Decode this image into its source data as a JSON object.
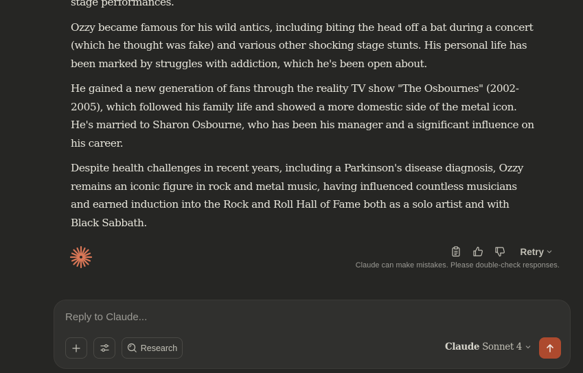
{
  "message": {
    "partial_line": "stage performances.",
    "paragraphs": [
      "Ozzy became famous for his wild antics, including biting the head off a bat during a concert (which he thought was fake) and various other shocking stage stunts. His personal life has been marked by struggles with addiction, which he's been open about.",
      "He gained a new generation of fans through the reality TV show \"The Osbournes\" (2002-2005), which followed his family life and showed a more domestic side of the metal icon. He's married to Sharon Osbourne, who has been his manager and a significant influence on his career.",
      "Despite health challenges in recent years, including a Parkinson's disease diagnosis, Ozzy remains an iconic figure in rock and metal music, having influenced countless musicians and earned induction into the Rock and Roll Hall of Fame both as a solo artist and with Black Sabbath."
    ]
  },
  "message_actions": {
    "copy_icon": "clipboard-icon",
    "thumbs_up_icon": "thumbs-up-icon",
    "thumbs_down_icon": "thumbs-down-icon",
    "retry_label": "Retry",
    "disclaimer": "Claude can make mistakes. Please double-check responses."
  },
  "composer": {
    "placeholder": "Reply to Claude...",
    "research_label": "Research",
    "model_brand": "Claude",
    "model_name": "Sonnet 4"
  },
  "colors": {
    "background": "#262624",
    "composer_bg": "#30302e",
    "accent": "#ad4a2e",
    "logo": "#d97757",
    "text": "#e8e6dc"
  }
}
